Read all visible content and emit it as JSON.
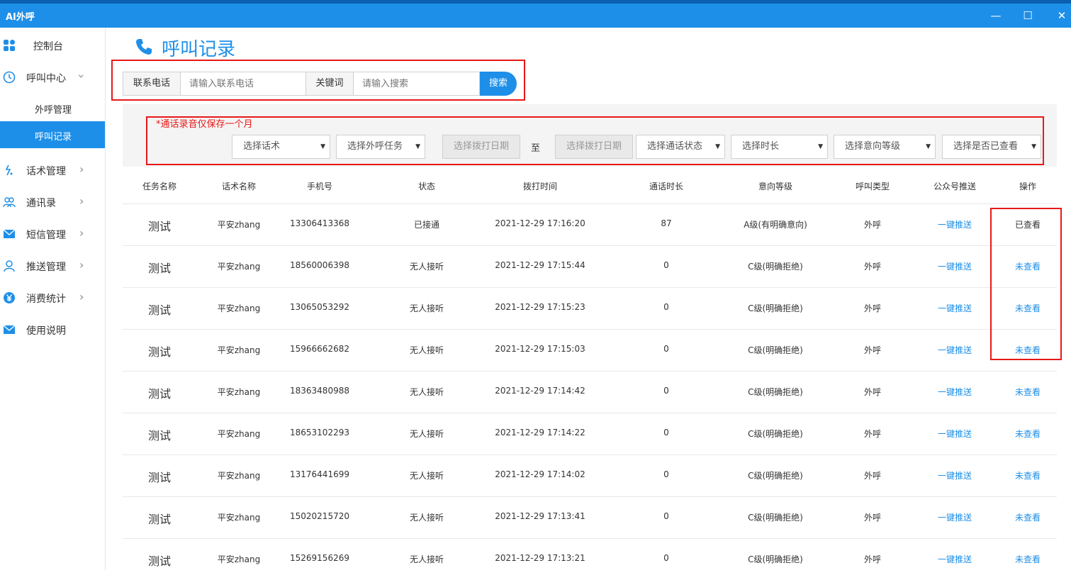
{
  "window": {
    "title": "AI外呼",
    "minimize": "—",
    "maximize": "☐",
    "close": "✕"
  },
  "sidebar": {
    "items": [
      {
        "label": "控制台",
        "icon": "dashboard-icon"
      },
      {
        "label": "呼叫中心",
        "icon": "clock-icon",
        "expanded": true
      },
      {
        "label": "外呼管理",
        "sub": true
      },
      {
        "label": "呼叫记录",
        "sub": true,
        "active": true
      },
      {
        "label": "话术管理",
        "icon": "script-icon"
      },
      {
        "label": "通讯录",
        "icon": "contacts-icon"
      },
      {
        "label": "短信管理",
        "icon": "mail-icon"
      },
      {
        "label": "推送管理",
        "icon": "user-icon"
      },
      {
        "label": "消费统计",
        "icon": "yen-icon"
      },
      {
        "label": "使用说明",
        "icon": "mail-icon"
      }
    ]
  },
  "page": {
    "title": "呼叫记录"
  },
  "search": {
    "phone_label": "联系电话",
    "phone_placeholder": "请输入联系电话",
    "keyword_label": "关键词",
    "keyword_placeholder": "请输入搜索",
    "button": "搜索"
  },
  "filters": {
    "notice": "*通话录音仅保存一个月",
    "script": "选择话术",
    "task": "选择外呼任务",
    "date_from": "选择拨打日期",
    "to": "至",
    "date_to": "选择拨打日期",
    "call_status": "选择通话状态",
    "duration": "选择时长",
    "intent_level": "选择意向等级",
    "viewed": "选择是否已查看"
  },
  "table": {
    "headers": [
      "任务名称",
      "话术名称",
      "手机号",
      "状态",
      "拨打时间",
      "通话时长",
      "意向等级",
      "呼叫类型",
      "公众号推送",
      "操作"
    ],
    "rows": [
      [
        "测试",
        "平安zhang",
        "13306413368",
        "已接通",
        "2021-12-29 17:16:20",
        "87",
        "A级(有明确意向)",
        "外呼",
        "一键推送",
        "已查看"
      ],
      [
        "测试",
        "平安zhang",
        "18560006398",
        "无人接听",
        "2021-12-29 17:15:44",
        "0",
        "C级(明确拒绝)",
        "外呼",
        "一键推送",
        "未查看"
      ],
      [
        "测试",
        "平安zhang",
        "13065053292",
        "无人接听",
        "2021-12-29 17:15:23",
        "0",
        "C级(明确拒绝)",
        "外呼",
        "一键推送",
        "未查看"
      ],
      [
        "测试",
        "平安zhang",
        "15966662682",
        "无人接听",
        "2021-12-29 17:15:03",
        "0",
        "C级(明确拒绝)",
        "外呼",
        "一键推送",
        "未查看"
      ],
      [
        "测试",
        "平安zhang",
        "18363480988",
        "无人接听",
        "2021-12-29 17:14:42",
        "0",
        "C级(明确拒绝)",
        "外呼",
        "一键推送",
        "未查看"
      ],
      [
        "测试",
        "平安zhang",
        "18653102293",
        "无人接听",
        "2021-12-29 17:14:22",
        "0",
        "C级(明确拒绝)",
        "外呼",
        "一键推送",
        "未查看"
      ],
      [
        "测试",
        "平安zhang",
        "13176441699",
        "无人接听",
        "2021-12-29 17:14:02",
        "0",
        "C级(明确拒绝)",
        "外呼",
        "一键推送",
        "未查看"
      ],
      [
        "测试",
        "平安zhang",
        "15020215720",
        "无人接听",
        "2021-12-29 17:13:41",
        "0",
        "C级(明确拒绝)",
        "外呼",
        "一键推送",
        "未查看"
      ],
      [
        "测试",
        "平安zhang",
        "15269156269",
        "无人接听",
        "2021-12-29 17:13:21",
        "0",
        "C级(明确拒绝)",
        "外呼",
        "一键推送",
        "未查看"
      ]
    ]
  },
  "colors": {
    "accent": "#1e8fe8",
    "highlight": "#e81818"
  }
}
